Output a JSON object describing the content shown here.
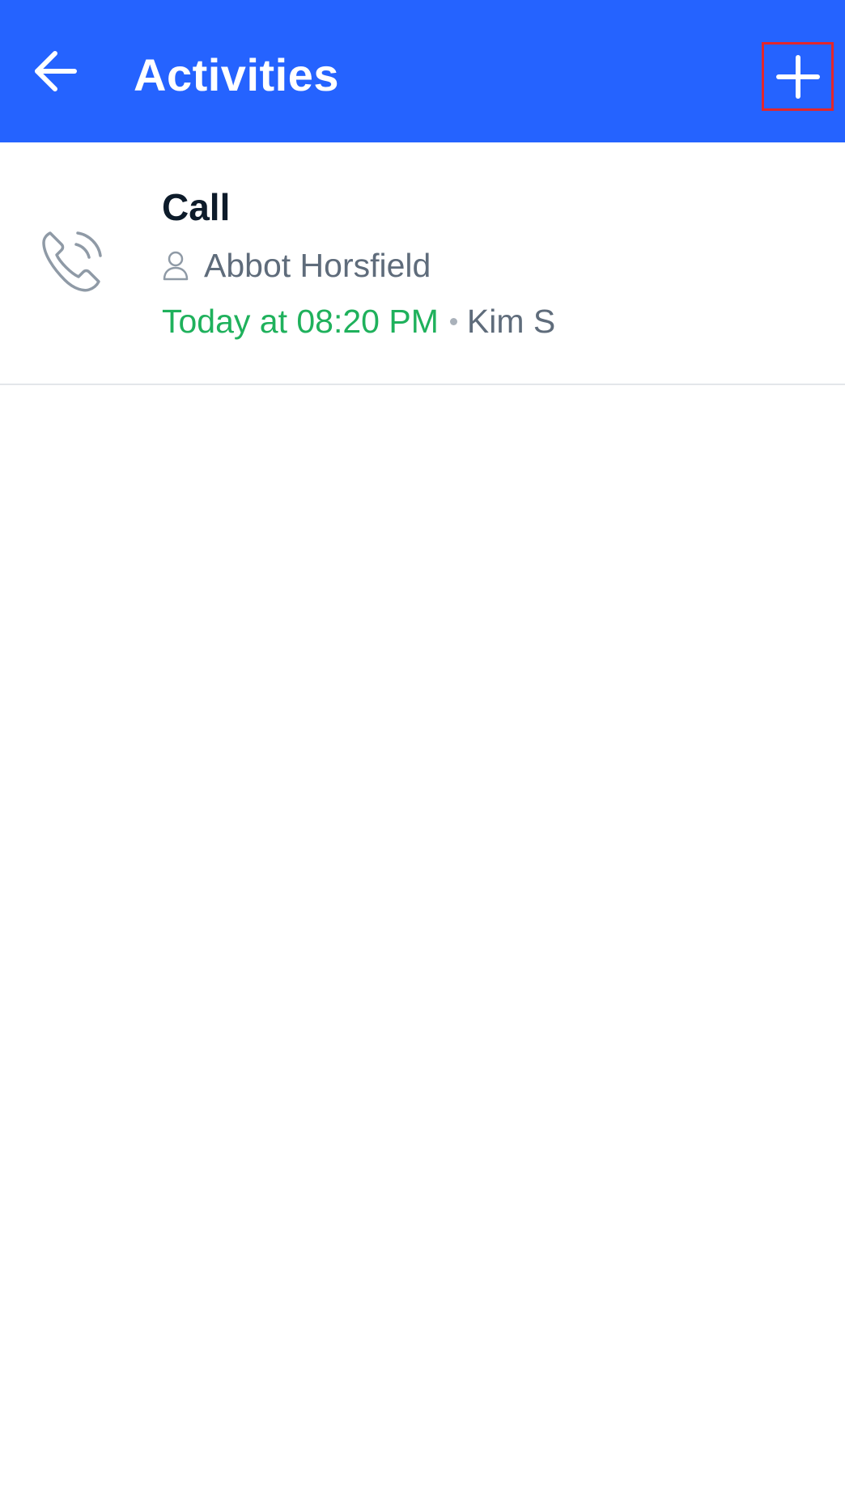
{
  "header": {
    "title": "Activities",
    "background_color": "#2563ff",
    "back_icon": "arrow-left-icon",
    "add_icon": "plus-icon"
  },
  "activities": [
    {
      "type_icon": "phone-ringing-icon",
      "title": "Call",
      "contact_icon": "person-icon",
      "contact": "Abbot Horsfield",
      "due": "Today at 08:20 PM",
      "separator": "•",
      "owner": "Kim S",
      "due_color": "#1fb15c"
    }
  ]
}
